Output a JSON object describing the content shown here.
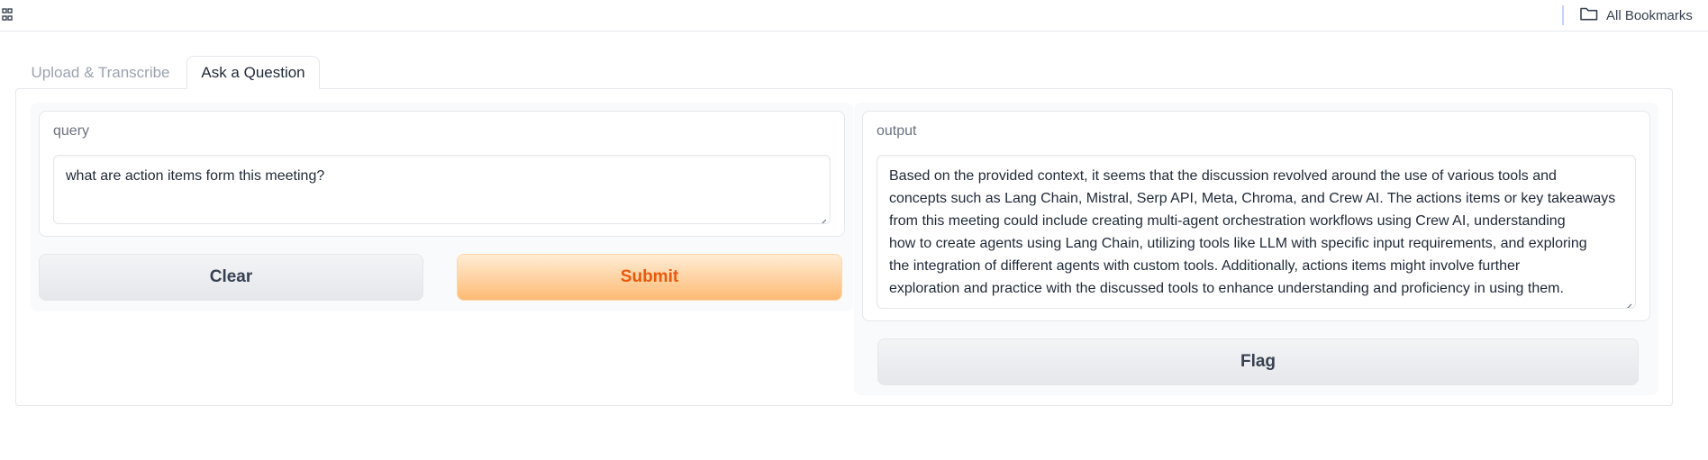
{
  "bookmarks_bar": {
    "apps_icon": "apps-grid-icon",
    "all_bookmarks_icon": "folder-icon",
    "all_bookmarks_label": "All Bookmarks"
  },
  "tabs": [
    {
      "label": "Upload & Transcribe",
      "active": false
    },
    {
      "label": "Ask a Question",
      "active": true
    }
  ],
  "query": {
    "label": "query",
    "value": "what are action items form this meeting?"
  },
  "buttons": {
    "clear_label": "Clear",
    "submit_label": "Submit",
    "flag_label": "Flag"
  },
  "output": {
    "label": "output",
    "lines": [
      "Based on the provided context, it seems that the discussion revolved around the use of various tools and",
      "concepts such as Lang Chain, Mistral, Serp API, Meta, Chroma, and Crew AI. The actions items or key takeaways",
      "from this meeting could include creating multi-agent orchestration workflows using Crew AI, understanding",
      "how to create agents using Lang Chain, utilizing tools like LLM with specific input requirements, and exploring",
      "the integration of different agents with custom tools. Additionally, actions items might involve further",
      "exploration and practice with the discussed tools to enhance understanding and proficiency in using them."
    ]
  },
  "colors": {
    "primary_text": "#ea580c",
    "primary_bg_top": "#ffedd5",
    "primary_bg_bottom": "#fdba74",
    "border": "#e5e7eb"
  }
}
